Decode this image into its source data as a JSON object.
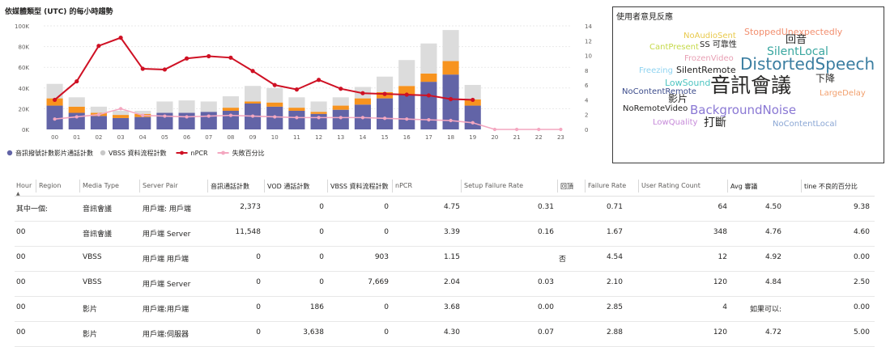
{
  "chart_data": {
    "type": "bar",
    "title": "依媒體類型 (UTC) 的每小時趨勢",
    "categories": [
      "00",
      "01",
      "02",
      "03",
      "04",
      "05",
      "06",
      "07",
      "08",
      "09",
      "10",
      "11",
      "12",
      "13",
      "14",
      "15",
      "16",
      "17",
      "18",
      "19",
      "20",
      "21",
      "22",
      "23"
    ],
    "series": [
      {
        "name": "音訊撥號計數",
        "kind": "bar-stack",
        "color": "#6264a7",
        "values": [
          23000,
          16000,
          13000,
          11000,
          12000,
          16000,
          16000,
          17000,
          18000,
          25000,
          22000,
          18000,
          15000,
          19000,
          24000,
          30000,
          34000,
          46000,
          53000,
          23000,
          0,
          0,
          0,
          0
        ]
      },
      {
        "name": "影片通話計數",
        "kind": "bar-stack",
        "color": "#f7931e",
        "values": [
          7000,
          6000,
          3000,
          3000,
          3000,
          0,
          0,
          0,
          3000,
          2000,
          4000,
          3000,
          2000,
          4000,
          6000,
          6000,
          8000,
          8000,
          13000,
          6000,
          0,
          0,
          0,
          0
        ]
      },
      {
        "name": "VBSS 資料流程計數",
        "kind": "bar-stack",
        "color": "#dcdcdc",
        "values": [
          14000,
          9000,
          6000,
          4000,
          3000,
          11000,
          12000,
          10000,
          11000,
          15000,
          14000,
          10000,
          10000,
          8000,
          11000,
          15000,
          25000,
          29000,
          30000,
          14000,
          0,
          0,
          0,
          0
        ]
      },
      {
        "name": "nPCR",
        "kind": "line",
        "color": "#cf1124",
        "axis": "right",
        "values": [
          4.0,
          6.5,
          11.3,
          12.4,
          8.2,
          8.1,
          9.6,
          9.9,
          9.7,
          7.9,
          6.0,
          5.4,
          6.7,
          5.5,
          4.9,
          4.8,
          4.7,
          4.6,
          4.1,
          4.0,
          null,
          null,
          null,
          null
        ]
      },
      {
        "name": "失敗百分比",
        "kind": "line",
        "color": "#f4a7c0",
        "axis": "right",
        "values": [
          1.4,
          1.7,
          2.0,
          2.8,
          1.9,
          1.8,
          1.7,
          1.8,
          1.9,
          1.8,
          1.7,
          1.6,
          1.6,
          1.6,
          1.6,
          1.5,
          1.4,
          1.3,
          1.2,
          0.9,
          0.0,
          0.0,
          0.0,
          0.0
        ]
      }
    ],
    "left_axis": {
      "ticks": [
        "0K",
        "20K",
        "40K",
        "60K",
        "80K",
        "100K"
      ],
      "ylim": [
        0,
        100000
      ]
    },
    "right_axis": {
      "ticks": [
        "0",
        "2",
        "4",
        "6",
        "8",
        "10",
        "12",
        "14"
      ],
      "ylim": [
        0,
        14
      ]
    },
    "legend": [
      {
        "label": "音訊撥號計數影片通話計數",
        "color": "#6264a7",
        "shape": "dot"
      },
      {
        "label": "VBSS 資料流程計數",
        "color": "#c8c8c8",
        "shape": "dot"
      },
      {
        "label": "nPCR",
        "color": "#cf1124",
        "shape": "line"
      },
      {
        "label": "失敗百分比",
        "color": "#f4a7c0",
        "shape": "line"
      }
    ],
    "legend_placement": "bottom"
  },
  "wordcloud": {
    "title": "使用者意見反應",
    "words": [
      {
        "text": "NoAudioSent",
        "color": "#e8c94c"
      },
      {
        "text": "StoppedUnexpectedly",
        "color": "#f28e6e"
      },
      {
        "text": "CantPresent",
        "color": "#c5d94a"
      },
      {
        "text": "SS 可靠性",
        "color": "#252423"
      },
      {
        "text": "回音",
        "color": "#252423"
      },
      {
        "text": "SilentLocal",
        "color": "#3aa7a0"
      },
      {
        "text": "FrozenVideo",
        "color": "#e8a0b4"
      },
      {
        "text": "DistortedSpeech",
        "color": "#3b7ea1"
      },
      {
        "text": "Freezing",
        "color": "#8fd3f0"
      },
      {
        "text": "SilentRemote",
        "color": "#252423"
      },
      {
        "text": "LowSound",
        "color": "#4ec5c1"
      },
      {
        "text": "音訊會議",
        "color": "#252423"
      },
      {
        "text": "下降",
        "color": "#252423"
      },
      {
        "text": "NoContentRemote",
        "color": "#3a4a8a"
      },
      {
        "text": "影片",
        "color": "#252423"
      },
      {
        "text": "LargeDelay",
        "color": "#f2a06e"
      },
      {
        "text": "NoRemoteVideo",
        "color": "#252423"
      },
      {
        "text": "BackgroundNoise",
        "color": "#8a78d4"
      },
      {
        "text": "LowQuality",
        "color": "#c68ad9"
      },
      {
        "text": "打斷",
        "color": "#252423"
      },
      {
        "text": "NoContentLocal",
        "color": "#8aa6d4"
      }
    ]
  },
  "table": {
    "headers": [
      "Hour",
      "Region",
      "Media Type",
      "Server Pair",
      "音訊通話計數",
      "VOD 通話計數",
      "VBSS 資料流程計數",
      "nPCR",
      "Setup Failure Rate",
      "回頂",
      "Failure Rate",
      "User Rating Count",
      "Avg 審議",
      "tine 不良的百分比"
    ],
    "rows": [
      [
        "其中一個:",
        "",
        "音訊會議",
        "用戶端: 用戶端",
        "2,373",
        "0",
        "0",
        "4.75",
        "0.31",
        "",
        "0.71",
        "64",
        "4.50",
        "9.38"
      ],
      [
        "00",
        "",
        "音訊會議",
        "用戶端 Server",
        "11,548",
        "0",
        "0",
        "3.39",
        "0.16",
        "",
        "1.67",
        "348",
        "4.76",
        "4.60"
      ],
      [
        "00",
        "",
        "VBSS",
        "用戶端 用戶端",
        "0",
        "0",
        "903",
        "1.15",
        "",
        "否",
        "4.54",
        "12",
        "4.92",
        "0.00"
      ],
      [
        "00",
        "",
        "VBSS",
        "用戶端 Server",
        "0",
        "0",
        "7,669",
        "2.04",
        "0.03",
        "",
        "2.10",
        "120",
        "4.84",
        "2.50"
      ],
      [
        "00",
        "",
        "影片",
        "用戶端:用戶端",
        "0",
        "186",
        "0",
        "3.68",
        "0.00",
        "",
        "2.85",
        "4",
        "如果可以:",
        "0.00"
      ],
      [
        "00",
        "",
        "影片",
        "用戶端:伺服器",
        "0",
        "3,638",
        "0",
        "4.30",
        "0.07",
        "",
        "2.88",
        "120",
        "4.72",
        "5.00"
      ]
    ]
  }
}
